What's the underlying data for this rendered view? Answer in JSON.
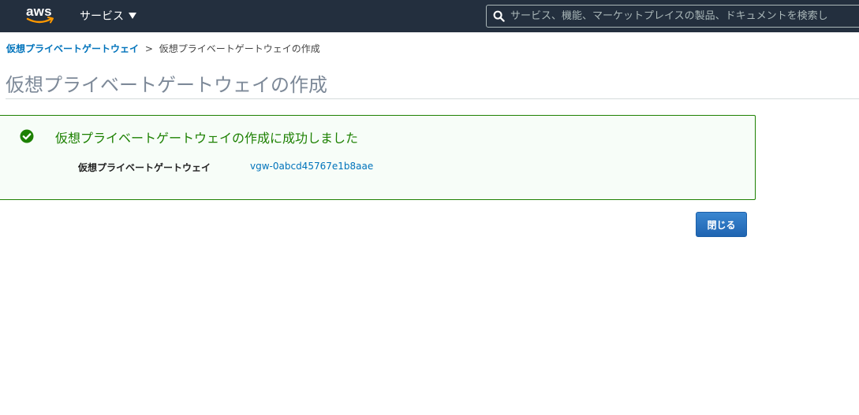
{
  "topnav": {
    "logo_text": "aws",
    "services_label": "サービス",
    "search_placeholder": "サービス、機能、マーケットプレイスの製品、ドキュメントを検索し"
  },
  "breadcrumb": {
    "parent": "仮想プライベートゲートウェイ",
    "separator": ">",
    "current": "仮想プライベートゲートウェイの作成"
  },
  "page": {
    "title": "仮想プライベートゲートウェイの作成"
  },
  "alert": {
    "title": "仮想プライベートゲートウェイの作成に成功しました",
    "detail_label": "仮想プライベートゲートウェイ",
    "detail_value": "vgw-0abcd45767e1b8aae"
  },
  "actions": {
    "close_label": "閉じる"
  },
  "colors": {
    "nav_bg": "#232f3e",
    "link": "#0073bb",
    "success": "#1d8102",
    "primary_button": "#1f64b1"
  },
  "icons": [
    "aws-logo",
    "caret-down-icon",
    "search-icon",
    "check-circle-icon"
  ]
}
